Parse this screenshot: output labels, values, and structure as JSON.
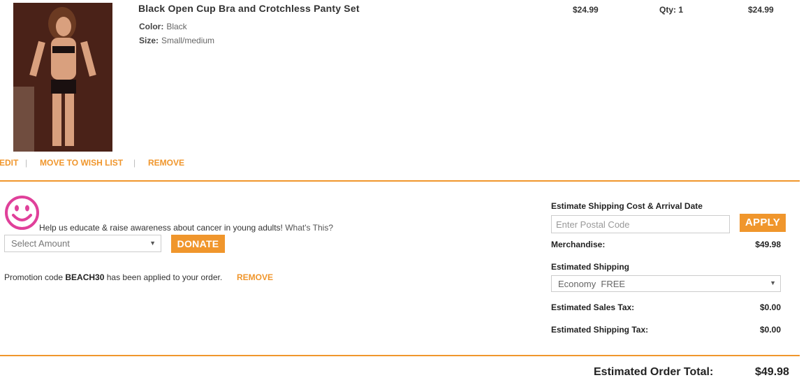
{
  "item": {
    "title": "Black Open Cup Bra and Crotchless Panty Set",
    "color_key": "Color:",
    "color_value": "Black",
    "size_key": "Size:",
    "size_value": "Small/medium",
    "unit_price": "$24.99",
    "qty": "Qty: 1",
    "line_total": "$24.99",
    "actions": {
      "edit": "EDIT",
      "wishlist": "MOVE TO WISH LIST",
      "remove": "REMOVE",
      "separator": "|"
    }
  },
  "donation": {
    "text": "Help us educate & raise awareness about cancer in young adults!",
    "link": "What's This?",
    "select_placeholder": "Select Amount",
    "donate_label": "DONATE"
  },
  "promo": {
    "prefix": "Promotion code",
    "code": "BEACH30",
    "suffix": "has been applied to your order.",
    "remove_label": "REMOVE"
  },
  "summary": {
    "estimate_heading": "Estimate Shipping Cost & Arrival Date",
    "postal_placeholder": "Enter Postal Code",
    "apply_label": "APPLY",
    "merchandise_label": "Merchandise:",
    "merchandise_value": "$49.98",
    "shipping_label": "Estimated Shipping",
    "shipping_option": "Economy  FREE",
    "sales_tax_label": "Estimated Sales Tax:",
    "sales_tax_value": "$0.00",
    "shipping_tax_label": "Estimated Shipping Tax:",
    "shipping_tax_value": "$0.00",
    "order_total_label": "Estimated Order Total:",
    "order_total_value": "$49.98"
  },
  "colors": {
    "accent": "#f0962c",
    "smiley": "#e0409a"
  }
}
